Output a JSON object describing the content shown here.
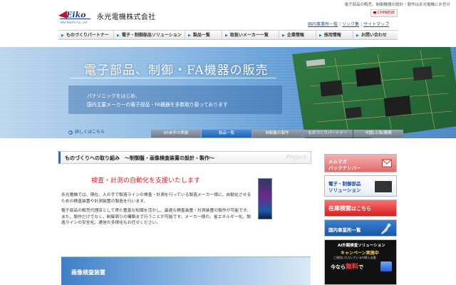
{
  "header": {
    "tagline": "電子部品の販売、制御機器の設計・製作は永光電機にお任せ",
    "logo_text": "Eiko",
    "logo_sub": "Eiko Electric Co., Ltd",
    "company_name": "永光電機株式会社",
    "chinese_label": "CHINESE",
    "util_links": [
      "国内事業所一覧",
      "リンク集",
      "サイトマップ"
    ]
  },
  "nav": {
    "items": [
      "ものづくりパートナー",
      "電子・制御部品ソリューション",
      "製品一覧",
      "取扱いメーカー一覧",
      "企業情報",
      "採用情報",
      "お問い合わせ"
    ]
  },
  "hero": {
    "title": "電子部品、制御・FA機器の販売",
    "desc_line1": "パナソニックをはじめ、",
    "desc_line2": "国内主要メーカーの電子部品・FA機器を多数取り扱っております",
    "detail_link": "詳しくはこちら",
    "tabs": [
      "60余年の実績",
      "製品一覧",
      "制御盤の製作",
      "ものづくりパートナー",
      "中国(上海)展開"
    ],
    "active_tab": 1
  },
  "main": {
    "section_title": "ものづくりへの取り組み　～制御盤・画像検査装置の設計・製作～",
    "section_watermark": "Project",
    "red_heading": "検査・計測の自動化を支援いたします",
    "para1": "永光電機では、現在、人の手で製造ラインの検査・計測を行っている製造メーカー様に、自動化させるための検査装置や計測装置の製造を行います。",
    "para2": "電子部品の販売代理店として得た豊富な知識を活かし、最適な検査装置・計測装置の製作が可能です。また、製作だけでなく、制御周りの構築まで行うことが可能です。メーカー様の、省エネルギー化、製造ラインの安全化、通信の多様化もお任せください。",
    "banner_title": "画像検査装置"
  },
  "sidebar": {
    "mailmag_1": "メルマガ",
    "mailmag_2": "バックナンバー",
    "solution_1": "電子・制御部品",
    "solution_2": "ソリューション",
    "stock_1": "在庫検索",
    "stock_2": "はこちら",
    "offices": "国内事業所一覧",
    "ai_title": "AI外観検査ソリューション",
    "ai_campaign": "キャンペーン実施中",
    "ai_sub": "ご使用いただいているAI導入支援",
    "ai_free_pre": "今なら",
    "ai_free": "無料",
    "ai_free_post": "で"
  },
  "colors": {
    "accent_blue": "#2a6cc0",
    "red_heading": "#d02828",
    "hero_blue": "#5f9bd4"
  }
}
